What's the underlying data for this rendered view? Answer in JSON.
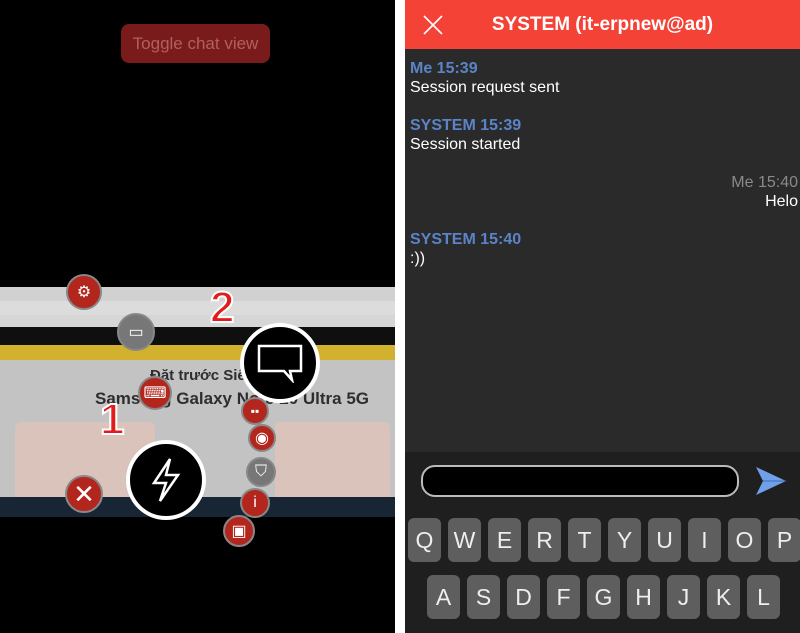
{
  "left": {
    "toggle_label": "Toggle chat view",
    "markers": [
      "1",
      "2"
    ],
    "desktop_page_texts": [
      "Đặt trước Siêu",
      "Samsung Galaxy Note 20 Ultra 5G"
    ],
    "tool_icons": [
      "gear-icon",
      "monitor-icon",
      "keyboard-icon",
      "close-icon",
      "lightning-icon",
      "chat-icon",
      "layout-icon",
      "camera-icon",
      "shield-icon",
      "info-icon",
      "screen-share-icon"
    ],
    "accent": "#b3261e"
  },
  "chat": {
    "title": "SYSTEM (it-erpnew@ad)",
    "header_color": "#f44336",
    "messages": [
      {
        "meta": "Me 15:39",
        "text": "Session request sent",
        "align": "left"
      },
      {
        "meta": "SYSTEM 15:39",
        "text": "Session started",
        "align": "left"
      },
      {
        "meta": "Me 15:40",
        "text": "Helo",
        "align": "right"
      },
      {
        "meta": "SYSTEM 15:40",
        "text": ":))",
        "align": "left"
      }
    ],
    "input_value": "",
    "send_icon": "send-icon",
    "keyboard": {
      "row1": [
        "Q",
        "W",
        "E",
        "R",
        "T",
        "Y",
        "U",
        "I",
        "O",
        "P"
      ],
      "row2": [
        "A",
        "S",
        "D",
        "F",
        "G",
        "H",
        "J",
        "K",
        "L"
      ]
    }
  }
}
